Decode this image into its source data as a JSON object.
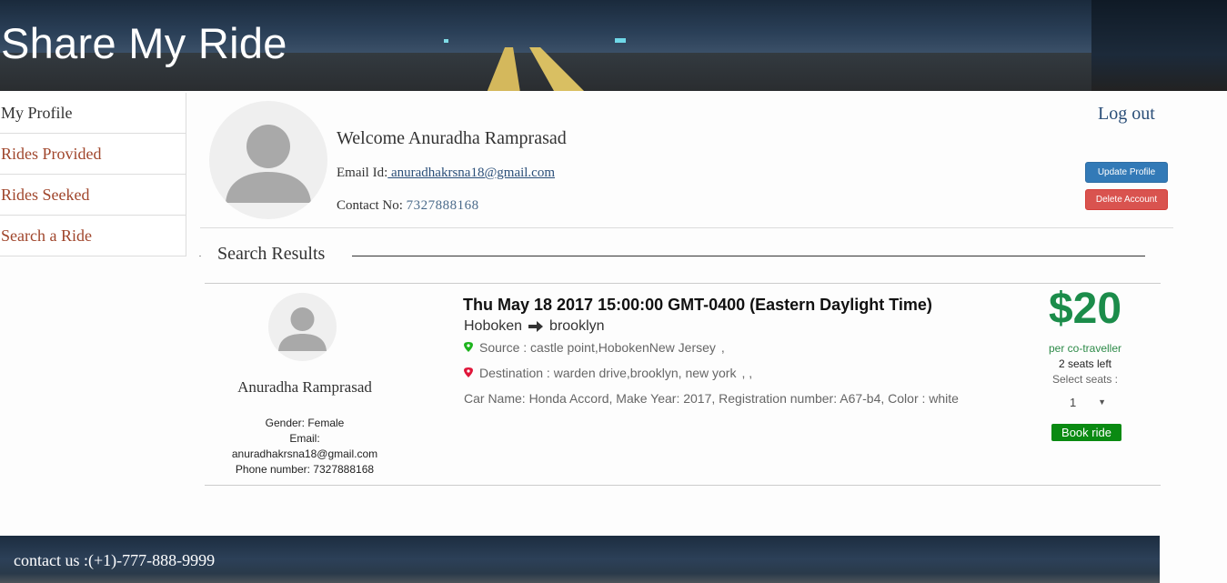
{
  "header": {
    "title": "Share My Ride"
  },
  "sidebar": {
    "items": [
      {
        "label": "My Profile"
      },
      {
        "label": "Rides Provided"
      },
      {
        "label": "Rides Seeked"
      },
      {
        "label": "Search a Ride"
      }
    ]
  },
  "profile": {
    "welcome": "Welcome Anuradha Ramprasad",
    "email_label": "Email Id:",
    "email": " anuradhakrsna18@gmail.com",
    "contact_label": "Contact No:",
    "contact": "7327888168",
    "logout": "Log out",
    "update_button": "Update Profile",
    "delete_button": "Delete Account"
  },
  "search": {
    "title": "Search Results"
  },
  "ride": {
    "driver_name": "Anuradha Ramprasad",
    "gender": "Gender: Female",
    "email_label": "Email:",
    "email": "anuradhakrsna18@gmail.com",
    "phone": "Phone number: 7327888168",
    "date": "Thu May 18 2017 15:00:00 GMT-0400 (Eastern Daylight Time)",
    "from": "Hoboken",
    "to": "brooklyn",
    "source": "Source : castle point,HobokenNew Jersey",
    "source_suffix": ",",
    "destination": "Destination : warden drive,brooklyn, new york",
    "destination_suffix": ",  ,",
    "car": "Car Name: Honda Accord, Make Year: 2017, Registration number: A67-b4, Color : white",
    "price": "$20",
    "per": "per co-traveller",
    "seats_left": "2 seats left",
    "select_label": "Select seats :",
    "selected_seats": "1",
    "book": "Book ride"
  },
  "footer": {
    "contact": "contact us :(+1)-777-888-9999"
  },
  "colors": {
    "link": "#2a4e78",
    "sidebar_link": "#a0462c",
    "price": "#1b8c4a",
    "book": "#0a8a12",
    "update": "#337ab7",
    "delete": "#d9534f"
  },
  "icons": {
    "arrow": "arrow-right-icon",
    "source": "map-pin-green-icon",
    "destination": "map-pin-red-icon"
  }
}
